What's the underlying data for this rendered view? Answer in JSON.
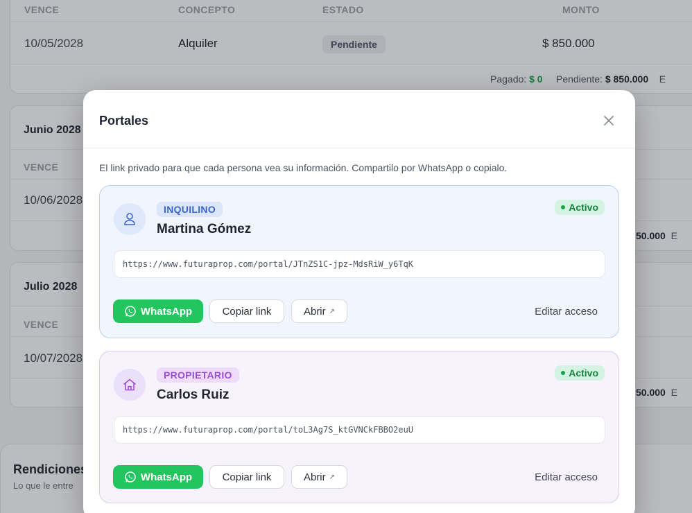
{
  "background": {
    "table_headers": {
      "due": "VENCE",
      "concept": "CONCEPTO",
      "status": "ESTADO",
      "amount": "MONTO"
    },
    "may_row": {
      "due": "10/05/2028",
      "concept": "Alquiler",
      "status": "Pendiente",
      "amount": "$ 850.000"
    },
    "may_summary": {
      "paid_label": "Pagado:",
      "paid_value": "$ 0",
      "pending_label": "Pendiente:",
      "pending_value": "$ 850.000",
      "trailing": "E"
    },
    "june": {
      "title": "Junio 2028",
      "due_header": "VENCE",
      "due": "10/06/2028",
      "amount_fragment": "50.000",
      "trailing": "E"
    },
    "july": {
      "title": "Julio 2028",
      "due_header": "VENCE",
      "due": "10/07/2028",
      "amount_fragment": "50.000",
      "trailing": "E"
    },
    "rendiciones": {
      "title": "Rendiciones",
      "subtitle": "Lo que le entre"
    }
  },
  "modal": {
    "title": "Portales",
    "description": "El link privado para que cada persona vea su información. Compartilo por WhatsApp o copialo.",
    "portals": [
      {
        "role": "INQUILINO",
        "name": "Martina Gómez",
        "status": "Activo",
        "link": "https://www.futuraprop.com/portal/JTnZS1C-jpz-MdsRiW_y6TqK",
        "whatsapp_label": "WhatsApp",
        "copy_label": "Copiar link",
        "open_label": "Abrir",
        "edit_label": "Editar acceso",
        "icon": "user-icon"
      },
      {
        "role": "PROPIETARIO",
        "name": "Carlos Ruiz",
        "status": "Activo",
        "link": "https://www.futuraprop.com/portal/toL3Ag7S_ktGVNCkFBBO2euU",
        "whatsapp_label": "WhatsApp",
        "copy_label": "Copiar link",
        "open_label": "Abrir",
        "edit_label": "Editar acceso",
        "icon": "home-icon"
      }
    ]
  },
  "colors": {
    "whatsapp_green": "#22c55e",
    "tenant_accent": "#3b67c8",
    "owner_accent": "#9b4fd0",
    "active_green": "#15803d"
  }
}
